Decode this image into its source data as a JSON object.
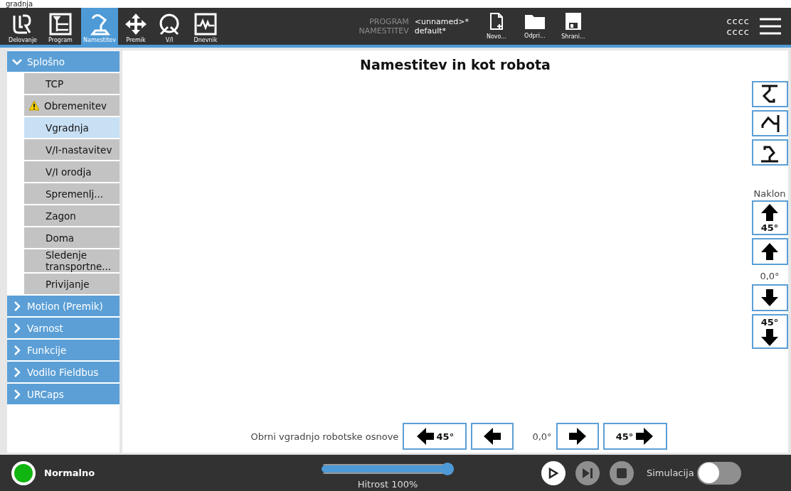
{
  "top_cut_text": "gradnja",
  "nav_tabs": [
    {
      "label": "Delovanje",
      "kind": "logo",
      "selected": false
    },
    {
      "label": "Program",
      "kind": "program",
      "selected": false
    },
    {
      "label": "Namestitev",
      "kind": "robot",
      "selected": true
    },
    {
      "label": "Premik",
      "kind": "move",
      "selected": false
    },
    {
      "label": "V/I",
      "kind": "io",
      "selected": false
    },
    {
      "label": "Dnevnik",
      "kind": "log",
      "selected": false
    }
  ],
  "program_info": {
    "program_label": "PROGRAM",
    "program_value": "<unnamed>*",
    "installation_label": "NAMESTITEV",
    "installation_value": "default*"
  },
  "file_buttons": [
    {
      "label": "Novo...",
      "kind": "new"
    },
    {
      "label": "Odpri...",
      "kind": "open"
    },
    {
      "label": "Shrani...",
      "kind": "save"
    }
  ],
  "user_lines": [
    "cccc",
    "cccc"
  ],
  "sidebar": [
    {
      "label": "Splošno",
      "expanded": true,
      "children": [
        {
          "label": "TCP",
          "selected": false,
          "warning": false
        },
        {
          "label": "Obremenitev",
          "selected": false,
          "warning": true
        },
        {
          "label": "Vgradnja",
          "selected": true,
          "warning": false
        },
        {
          "label": "V/I-nastavitev",
          "selected": false,
          "warning": false
        },
        {
          "label": "V/I orodja",
          "selected": false,
          "warning": false
        },
        {
          "label": "Spremenlj...",
          "selected": false,
          "warning": false
        },
        {
          "label": "Zagon",
          "selected": false,
          "warning": false
        },
        {
          "label": "Doma",
          "selected": false,
          "warning": false
        },
        {
          "label": "Sledenje transportne...",
          "selected": false,
          "warning": false
        },
        {
          "label": "Privijanje",
          "selected": false,
          "warning": false
        }
      ]
    },
    {
      "label": "Motion (Premik)",
      "expanded": false
    },
    {
      "label": "Varnost",
      "expanded": false
    },
    {
      "label": "Funkcije",
      "expanded": false
    },
    {
      "label": "Vodilo Fieldbus",
      "expanded": false
    },
    {
      "label": "URCaps",
      "expanded": false
    }
  ],
  "main": {
    "title": "Namestitev in kot robota",
    "view_buttons": [
      {
        "kind": "ceiling"
      },
      {
        "kind": "wall"
      },
      {
        "kind": "floor"
      }
    ],
    "tilt": {
      "label": "Naklon",
      "reading": "0,0°",
      "before": [
        {
          "kind": "up",
          "text": "45°"
        },
        {
          "kind": "up"
        }
      ],
      "after": [
        {
          "kind": "down"
        },
        {
          "kind": "down",
          "text": "45°"
        }
      ]
    },
    "rotate": {
      "label": "Obrni vgradnjo robotske osnove",
      "reading": "0,0°",
      "before": [
        {
          "kind": "left",
          "text": "45°"
        },
        {
          "kind": "left"
        }
      ],
      "after": [
        {
          "kind": "right"
        },
        {
          "kind": "right",
          "text": "45°"
        }
      ]
    }
  },
  "status_bar": {
    "status": "Normalno",
    "speed": {
      "label": "Hitrost 100%",
      "level": 1.0
    },
    "controls": [
      {
        "kind": "play",
        "disabled": false
      },
      {
        "kind": "step",
        "disabled": true
      },
      {
        "kind": "stop",
        "disabled": true
      }
    ],
    "simulation": {
      "label": "Simulacija",
      "on": false
    }
  }
}
